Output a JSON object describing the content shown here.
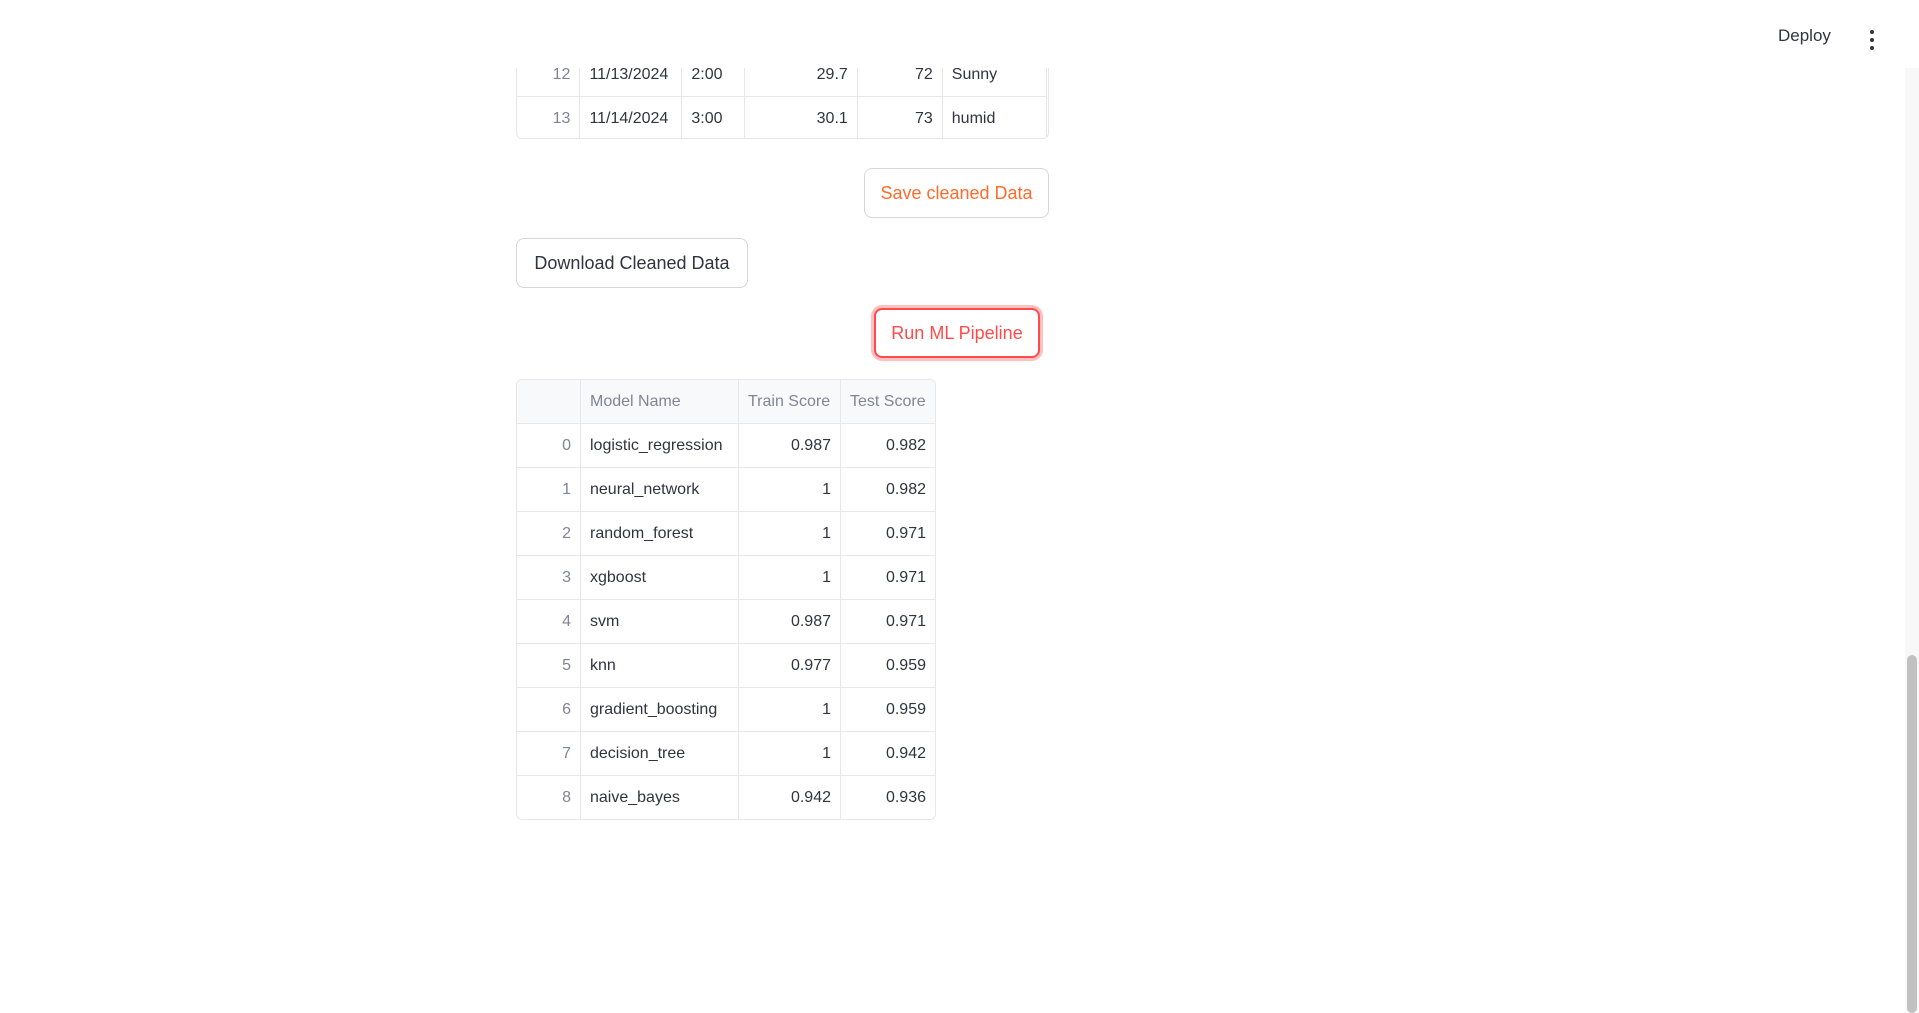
{
  "header": {
    "deploy_label": "Deploy",
    "menu_icon": "kebab-menu-icon"
  },
  "data_table": {
    "rows": [
      {
        "index": "12",
        "date": "11/13/2024",
        "time": "2:00",
        "temp": "29.7",
        "humidity": "72",
        "condition": "Sunny"
      },
      {
        "index": "13",
        "date": "11/14/2024",
        "time": "3:00",
        "temp": "30.1",
        "humidity": "73",
        "condition": "humid"
      }
    ]
  },
  "buttons": {
    "save_label": "Save cleaned Data",
    "download_label": "Download Cleaned Data",
    "run_label": "Run ML Pipeline"
  },
  "results_table": {
    "columns": [
      "",
      "Model Name",
      "Train Score",
      "Test Score"
    ],
    "rows": [
      {
        "index": "0",
        "model": "logistic_regression",
        "train": "0.987",
        "test": "0.982"
      },
      {
        "index": "1",
        "model": "neural_network",
        "train": "1",
        "test": "0.982"
      },
      {
        "index": "2",
        "model": "random_forest",
        "train": "1",
        "test": "0.971"
      },
      {
        "index": "3",
        "model": "xgboost",
        "train": "1",
        "test": "0.971"
      },
      {
        "index": "4",
        "model": "svm",
        "train": "0.987",
        "test": "0.971"
      },
      {
        "index": "5",
        "model": "knn",
        "train": "0.977",
        "test": "0.959"
      },
      {
        "index": "6",
        "model": "gradient_boosting",
        "train": "1",
        "test": "0.959"
      },
      {
        "index": "7",
        "model": "decision_tree",
        "train": "1",
        "test": "0.942"
      },
      {
        "index": "8",
        "model": "naive_bayes",
        "train": "0.942",
        "test": "0.936"
      }
    ]
  },
  "colors": {
    "accent_red": "#ff4b4b",
    "save_orange": "#ff6b2c",
    "text": "#31333f",
    "muted": "#808495",
    "border": "#e6e7ea"
  }
}
